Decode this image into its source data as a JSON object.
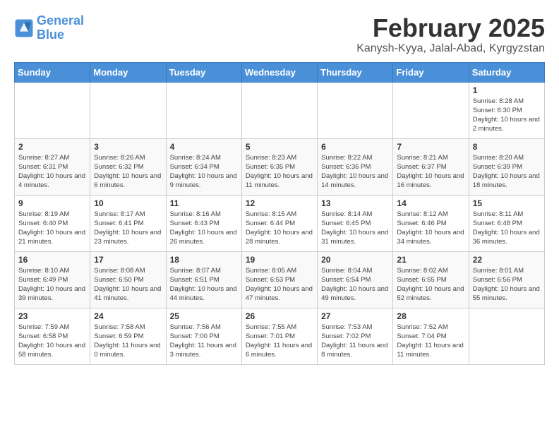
{
  "logo": {
    "line1": "General",
    "line2": "Blue"
  },
  "title": "February 2025",
  "subtitle": "Kanysh-Kyya, Jalal-Abad, Kyrgyzstan",
  "days_of_week": [
    "Sunday",
    "Monday",
    "Tuesday",
    "Wednesday",
    "Thursday",
    "Friday",
    "Saturday"
  ],
  "weeks": [
    [
      {
        "day": "",
        "info": ""
      },
      {
        "day": "",
        "info": ""
      },
      {
        "day": "",
        "info": ""
      },
      {
        "day": "",
        "info": ""
      },
      {
        "day": "",
        "info": ""
      },
      {
        "day": "",
        "info": ""
      },
      {
        "day": "1",
        "info": "Sunrise: 8:28 AM\nSunset: 6:30 PM\nDaylight: 10 hours and 2 minutes."
      }
    ],
    [
      {
        "day": "2",
        "info": "Sunrise: 8:27 AM\nSunset: 6:31 PM\nDaylight: 10 hours and 4 minutes."
      },
      {
        "day": "3",
        "info": "Sunrise: 8:26 AM\nSunset: 6:32 PM\nDaylight: 10 hours and 6 minutes."
      },
      {
        "day": "4",
        "info": "Sunrise: 8:24 AM\nSunset: 6:34 PM\nDaylight: 10 hours and 9 minutes."
      },
      {
        "day": "5",
        "info": "Sunrise: 8:23 AM\nSunset: 6:35 PM\nDaylight: 10 hours and 11 minutes."
      },
      {
        "day": "6",
        "info": "Sunrise: 8:22 AM\nSunset: 6:36 PM\nDaylight: 10 hours and 14 minutes."
      },
      {
        "day": "7",
        "info": "Sunrise: 8:21 AM\nSunset: 6:37 PM\nDaylight: 10 hours and 16 minutes."
      },
      {
        "day": "8",
        "info": "Sunrise: 8:20 AM\nSunset: 6:39 PM\nDaylight: 10 hours and 18 minutes."
      }
    ],
    [
      {
        "day": "9",
        "info": "Sunrise: 8:19 AM\nSunset: 6:40 PM\nDaylight: 10 hours and 21 minutes."
      },
      {
        "day": "10",
        "info": "Sunrise: 8:17 AM\nSunset: 6:41 PM\nDaylight: 10 hours and 23 minutes."
      },
      {
        "day": "11",
        "info": "Sunrise: 8:16 AM\nSunset: 6:43 PM\nDaylight: 10 hours and 26 minutes."
      },
      {
        "day": "12",
        "info": "Sunrise: 8:15 AM\nSunset: 6:44 PM\nDaylight: 10 hours and 28 minutes."
      },
      {
        "day": "13",
        "info": "Sunrise: 8:14 AM\nSunset: 6:45 PM\nDaylight: 10 hours and 31 minutes."
      },
      {
        "day": "14",
        "info": "Sunrise: 8:12 AM\nSunset: 6:46 PM\nDaylight: 10 hours and 34 minutes."
      },
      {
        "day": "15",
        "info": "Sunrise: 8:11 AM\nSunset: 6:48 PM\nDaylight: 10 hours and 36 minutes."
      }
    ],
    [
      {
        "day": "16",
        "info": "Sunrise: 8:10 AM\nSunset: 6:49 PM\nDaylight: 10 hours and 39 minutes."
      },
      {
        "day": "17",
        "info": "Sunrise: 8:08 AM\nSunset: 6:50 PM\nDaylight: 10 hours and 41 minutes."
      },
      {
        "day": "18",
        "info": "Sunrise: 8:07 AM\nSunset: 6:51 PM\nDaylight: 10 hours and 44 minutes."
      },
      {
        "day": "19",
        "info": "Sunrise: 8:05 AM\nSunset: 6:53 PM\nDaylight: 10 hours and 47 minutes."
      },
      {
        "day": "20",
        "info": "Sunrise: 8:04 AM\nSunset: 6:54 PM\nDaylight: 10 hours and 49 minutes."
      },
      {
        "day": "21",
        "info": "Sunrise: 8:02 AM\nSunset: 6:55 PM\nDaylight: 10 hours and 52 minutes."
      },
      {
        "day": "22",
        "info": "Sunrise: 8:01 AM\nSunset: 6:56 PM\nDaylight: 10 hours and 55 minutes."
      }
    ],
    [
      {
        "day": "23",
        "info": "Sunrise: 7:59 AM\nSunset: 6:58 PM\nDaylight: 10 hours and 58 minutes."
      },
      {
        "day": "24",
        "info": "Sunrise: 7:58 AM\nSunset: 6:59 PM\nDaylight: 11 hours and 0 minutes."
      },
      {
        "day": "25",
        "info": "Sunrise: 7:56 AM\nSunset: 7:00 PM\nDaylight: 11 hours and 3 minutes."
      },
      {
        "day": "26",
        "info": "Sunrise: 7:55 AM\nSunset: 7:01 PM\nDaylight: 11 hours and 6 minutes."
      },
      {
        "day": "27",
        "info": "Sunrise: 7:53 AM\nSunset: 7:02 PM\nDaylight: 11 hours and 8 minutes."
      },
      {
        "day": "28",
        "info": "Sunrise: 7:52 AM\nSunset: 7:04 PM\nDaylight: 11 hours and 11 minutes."
      },
      {
        "day": "",
        "info": ""
      }
    ]
  ]
}
